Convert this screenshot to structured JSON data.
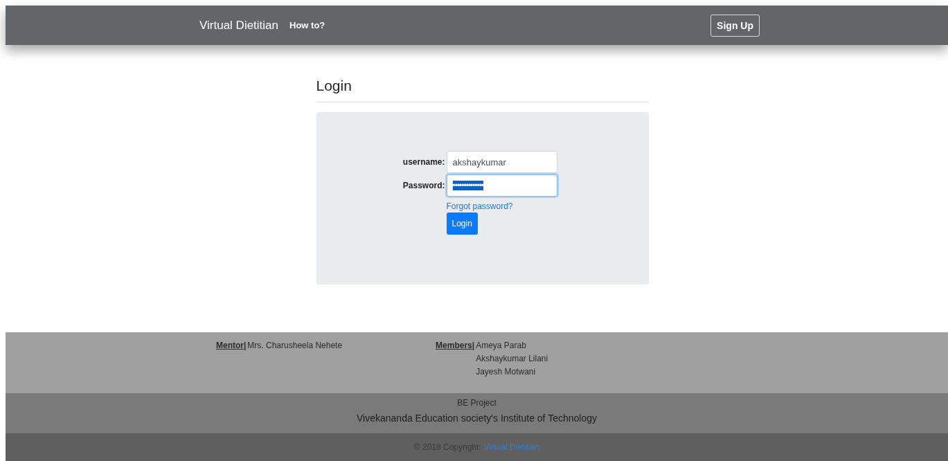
{
  "navbar": {
    "brand": "Virtual Dietitian",
    "links": [
      {
        "label": "How to?"
      }
    ],
    "button": "Sign Up"
  },
  "login": {
    "heading": "Login",
    "fields": [
      {
        "label": "username:",
        "value": "akshaykumar",
        "kind": "text",
        "focused": false
      },
      {
        "label": "Password:",
        "value": "••••••••••••••",
        "kind": "password",
        "focused": true
      }
    ],
    "forgot_link": "Forgot password?",
    "submit": "Login"
  },
  "footer": {
    "mentor": {
      "heading": "Mentor",
      "separator": "|",
      "names": [
        "Mrs. Charusheela Nehete"
      ]
    },
    "members": {
      "heading": "Members",
      "separator": "|",
      "names": [
        "Ameya Parab",
        "Akshaykumar Lilani",
        "Jayesh Motwani"
      ]
    },
    "project": "BE Project",
    "institute": "Vivekananda Education society's Institute of Technology",
    "copyright": "© 2018 Copyright:",
    "copyright_link": "Virtual Dietitian"
  }
}
